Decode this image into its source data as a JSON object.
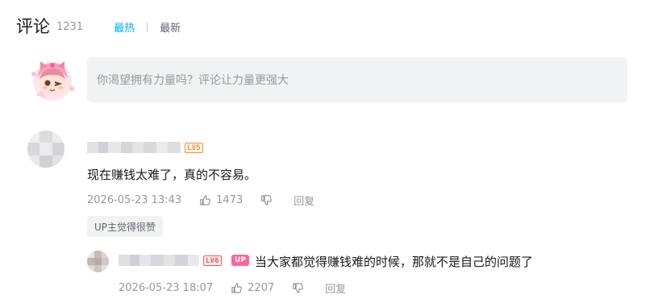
{
  "header": {
    "title": "评论",
    "count": "1231",
    "sort_hot": "最热",
    "sort_new": "最新"
  },
  "composer": {
    "placeholder": "你渴望拥有力量吗？评论让力量更强大"
  },
  "comments": [
    {
      "level_badge": "LV5",
      "text": "现在赚钱太难了，真的不容易。",
      "time": "2026-05-23 13:43",
      "likes": "1473",
      "reply_label": "回复",
      "up_liked_label": "UP主觉得很赞"
    }
  ],
  "reply": {
    "level_badge": "LV6",
    "up_tag": "UP",
    "text": "当大家都觉得赚钱难的时候，那就不是自己的问题了",
    "time": "2026-05-23 18:07",
    "likes": "2207",
    "reply_label": "回复"
  },
  "colors": {
    "accent": "#00aeec",
    "up_pink": "#ff6699",
    "lv5": "#ff8a2f",
    "lv6": "#ff4f4f"
  },
  "icons": [
    "thumbs-up-icon",
    "thumbs-down-icon"
  ]
}
